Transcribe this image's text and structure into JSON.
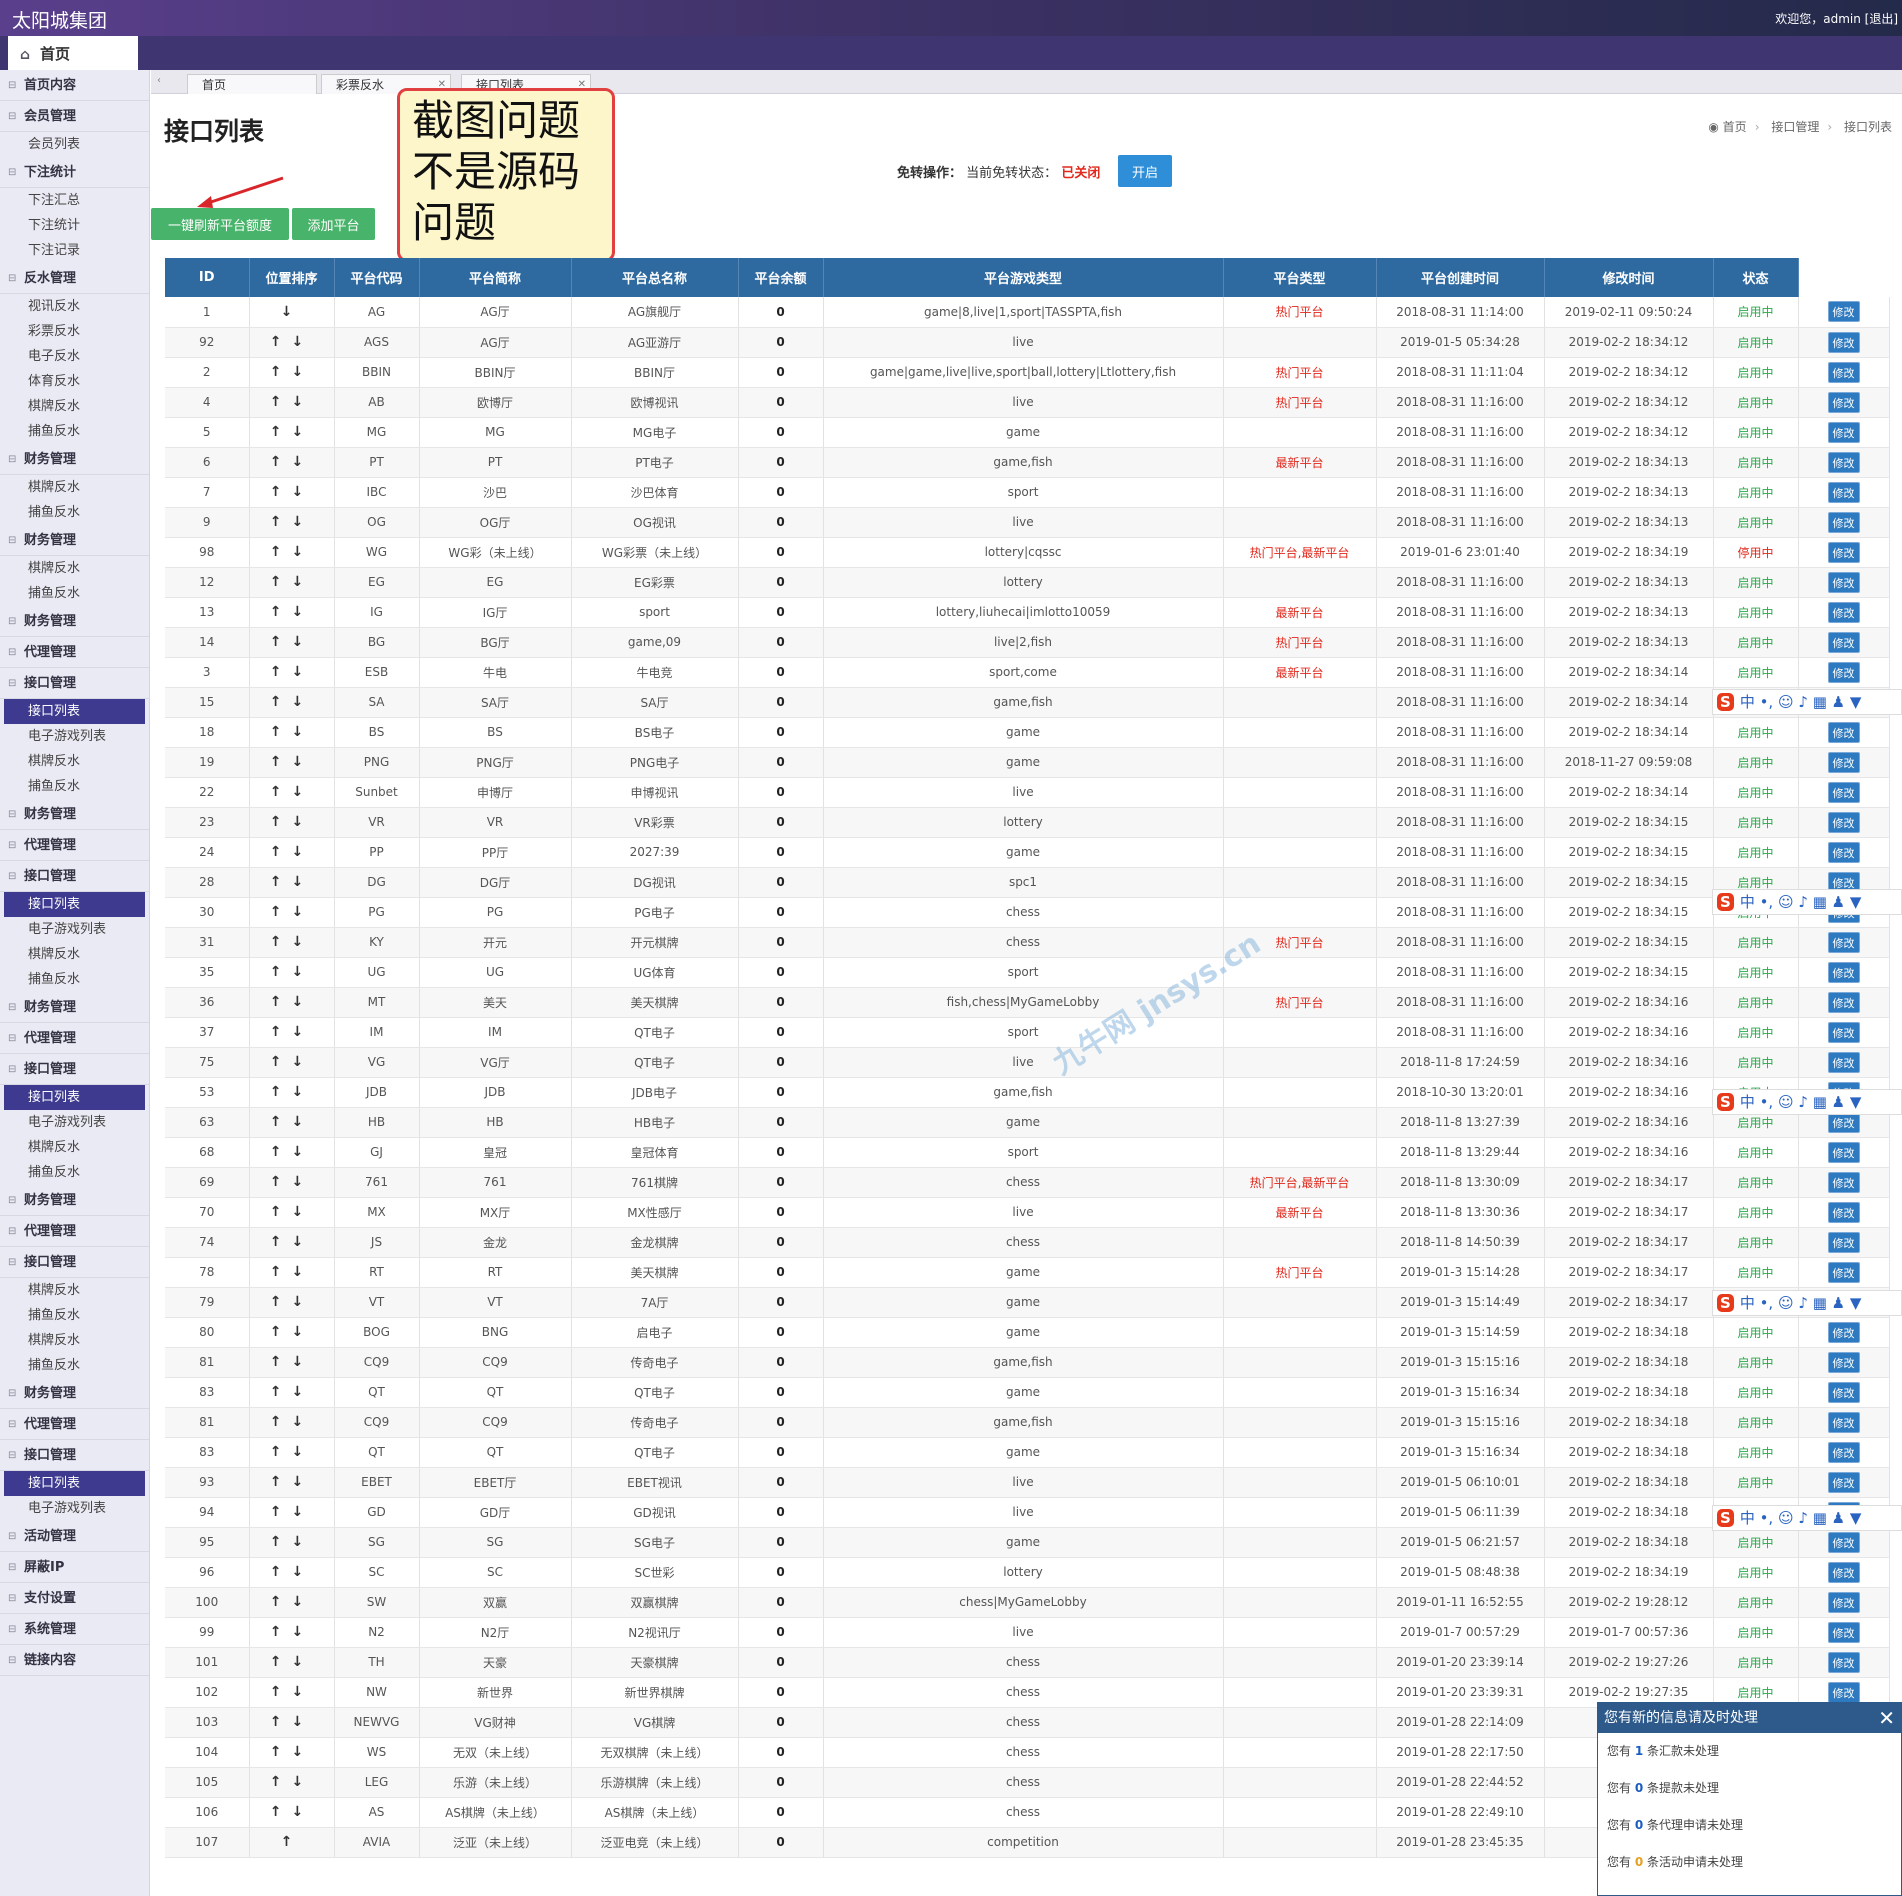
{
  "app": {
    "brand": "太阳城集团",
    "welcome": "欢迎您，admin [退出]",
    "home_tab": "首页"
  },
  "sidebar": [
    {
      "label": "首页内容",
      "type": "group"
    },
    {
      "label": "会员管理",
      "type": "group"
    },
    {
      "label": "会员列表",
      "type": "item"
    },
    {
      "label": "下注统计",
      "type": "group"
    },
    {
      "label": "下注汇总",
      "type": "item"
    },
    {
      "label": "下注统计",
      "type": "item"
    },
    {
      "label": "下注记录",
      "type": "item"
    },
    {
      "label": "反水管理",
      "type": "group"
    },
    {
      "label": "视讯反水",
      "type": "item"
    },
    {
      "label": "彩票反水",
      "type": "item"
    },
    {
      "label": "电子反水",
      "type": "item"
    },
    {
      "label": "体育反水",
      "type": "item"
    },
    {
      "label": "棋牌反水",
      "type": "item"
    },
    {
      "label": "捕鱼反水",
      "type": "item"
    },
    {
      "label": "财务管理",
      "type": "group"
    },
    {
      "label": "棋牌反水",
      "type": "item"
    },
    {
      "label": "捕鱼反水",
      "type": "item"
    },
    {
      "label": "财务管理",
      "type": "group"
    },
    {
      "label": "棋牌反水",
      "type": "item"
    },
    {
      "label": "捕鱼反水",
      "type": "item"
    },
    {
      "label": "财务管理",
      "type": "group"
    },
    {
      "label": "代理管理",
      "type": "group"
    },
    {
      "label": "接口管理",
      "type": "group"
    },
    {
      "label": "接口列表",
      "type": "item",
      "active": true
    },
    {
      "label": "电子游戏列表",
      "type": "item"
    },
    {
      "label": "棋牌反水",
      "type": "item"
    },
    {
      "label": "捕鱼反水",
      "type": "item"
    },
    {
      "label": "财务管理",
      "type": "group"
    },
    {
      "label": "代理管理",
      "type": "group"
    },
    {
      "label": "接口管理",
      "type": "group"
    },
    {
      "label": "接口列表",
      "type": "item",
      "active": true
    },
    {
      "label": "电子游戏列表",
      "type": "item"
    },
    {
      "label": "棋牌反水",
      "type": "item"
    },
    {
      "label": "捕鱼反水",
      "type": "item"
    },
    {
      "label": "财务管理",
      "type": "group"
    },
    {
      "label": "代理管理",
      "type": "group"
    },
    {
      "label": "接口管理",
      "type": "group"
    },
    {
      "label": "接口列表",
      "type": "item",
      "active": true
    },
    {
      "label": "电子游戏列表",
      "type": "item"
    },
    {
      "label": "棋牌反水",
      "type": "item"
    },
    {
      "label": "捕鱼反水",
      "type": "item"
    },
    {
      "label": "财务管理",
      "type": "group"
    },
    {
      "label": "代理管理",
      "type": "group"
    },
    {
      "label": "接口管理",
      "type": "group"
    },
    {
      "label": "棋牌反水",
      "type": "item"
    },
    {
      "label": "捕鱼反水",
      "type": "item"
    },
    {
      "label": "棋牌反水",
      "type": "item"
    },
    {
      "label": "捕鱼反水",
      "type": "item"
    },
    {
      "label": "财务管理",
      "type": "group"
    },
    {
      "label": "代理管理",
      "type": "group"
    },
    {
      "label": "接口管理",
      "type": "group"
    },
    {
      "label": "接口列表",
      "type": "item",
      "active": true
    },
    {
      "label": "电子游戏列表",
      "type": "item"
    },
    {
      "label": "活动管理",
      "type": "group"
    },
    {
      "label": "屏蔽IP",
      "type": "group"
    },
    {
      "label": "支付设置",
      "type": "group"
    },
    {
      "label": "系统管理",
      "type": "group"
    },
    {
      "label": "链接内容",
      "type": "group"
    }
  ],
  "tabs": [
    {
      "label": "首页"
    },
    {
      "label": "彩票反水"
    },
    {
      "label": "接口列表"
    }
  ],
  "page": {
    "title": "接口列表",
    "breadcrumb": [
      "首页",
      "接口管理",
      "接口列表"
    ],
    "toggle_label": "免转操作：",
    "toggle_state_prefix": "当前免转状态：",
    "toggle_state": "已关闭",
    "open_button": "开启",
    "refresh_button": "一键刷新平台额度",
    "add_button": "添加平台"
  },
  "annotation": "截图问题不是源码问题",
  "watermark": "九牛网 jnsys.cn",
  "table": {
    "headers": [
      "ID",
      "位置排序",
      "平台代码",
      "平台简称",
      "平台总名称",
      "平台余额",
      "平台游戏类型",
      "平台类型",
      "平台创建时间",
      "修改时间",
      "状态",
      ""
    ],
    "edit_label": "修改",
    "rows": [
      [
        "1",
        "↓",
        "AG",
        "AG厅",
        "AG旗舰厅",
        "0",
        "game|8,live|1,sport|TASSPTA,fish",
        "热门平台",
        "2018-08-31 11:14:00",
        "2019-02-11 09:50:24",
        "启用中"
      ],
      [
        "92",
        "↑↓",
        "AGS",
        "AG厅",
        "AG亚游厅",
        "0",
        "live",
        "",
        "2019-01-5 05:34:28",
        "2019-02-2 18:34:12",
        "启用中"
      ],
      [
        "2",
        "↑↓",
        "BBIN",
        "BBIN厅",
        "BBIN厅",
        "0",
        "game|game,live|live,sport|ball,lottery|Ltlottery,fish",
        "热门平台",
        "2018-08-31 11:11:04",
        "2019-02-2 18:34:12",
        "启用中"
      ],
      [
        "4",
        "↑↓",
        "AB",
        "欧博厅",
        "欧博视讯",
        "0",
        "live",
        "热门平台",
        "2018-08-31 11:16:00",
        "2019-02-2 18:34:12",
        "启用中"
      ],
      [
        "5",
        "↑↓",
        "MG",
        "MG",
        "MG电子",
        "0",
        "game",
        "",
        "2018-08-31 11:16:00",
        "2019-02-2 18:34:12",
        "启用中"
      ],
      [
        "6",
        "↑↓",
        "PT",
        "PT",
        "PT电子",
        "0",
        "game,fish",
        "最新平台",
        "2018-08-31 11:16:00",
        "2019-02-2 18:34:13",
        "启用中"
      ],
      [
        "7",
        "↑↓",
        "IBC",
        "沙巴",
        "沙巴体育",
        "0",
        "sport",
        "",
        "2018-08-31 11:16:00",
        "2019-02-2 18:34:13",
        "启用中"
      ],
      [
        "9",
        "↑↓",
        "OG",
        "OG厅",
        "OG视讯",
        "0",
        "live",
        "",
        "2018-08-31 11:16:00",
        "2019-02-2 18:34:13",
        "启用中"
      ],
      [
        "98",
        "↑↓",
        "WG",
        "WG彩（未上线）",
        "WG彩票（未上线）",
        "0",
        "lottery|cqssc",
        "热门平台,最新平台",
        "2019-01-6 23:01:40",
        "2019-02-2 18:34:19",
        "停用中"
      ],
      [
        "12",
        "↑↓",
        "EG",
        "EG",
        "EG彩票",
        "0",
        "lottery",
        "",
        "2018-08-31 11:16:00",
        "2019-02-2 18:34:13",
        "启用中"
      ],
      [
        "13",
        "↑↓",
        "IG",
        "IG厅",
        "sport",
        "0",
        "lottery,liuhecai|imlotto10059",
        "最新平台",
        "2018-08-31 11:16:00",
        "2019-02-2 18:34:13",
        "启用中"
      ],
      [
        "14",
        "↑↓",
        "BG",
        "BG厅",
        "game,09",
        "0",
        "live|2,fish",
        "热门平台",
        "2018-08-31 11:16:00",
        "2019-02-2 18:34:13",
        "启用中"
      ],
      [
        "3",
        "↑↓",
        "ESB",
        "牛电",
        "牛电竞",
        "0",
        "sport,come",
        "最新平台",
        "2018-08-31 11:16:00",
        "2019-02-2 18:34:14",
        "启用中"
      ],
      [
        "15",
        "↑↓",
        "SA",
        "SA厅",
        "SA厅",
        "0",
        "game,fish",
        "",
        "2018-08-31 11:16:00",
        "2019-02-2 18:34:14",
        "启用中"
      ],
      [
        "18",
        "↑↓",
        "BS",
        "BS",
        "BS电子",
        "0",
        "game",
        "",
        "2018-08-31 11:16:00",
        "2019-02-2 18:34:14",
        "启用中"
      ],
      [
        "19",
        "↑↓",
        "PNG",
        "PNG厅",
        "PNG电子",
        "0",
        "game",
        "",
        "2018-08-31 11:16:00",
        "2018-11-27 09:59:08",
        "启用中"
      ],
      [
        "22",
        "↑↓",
        "Sunbet",
        "申博厅",
        "申博视讯",
        "0",
        "live",
        "",
        "2018-08-31 11:16:00",
        "2019-02-2 18:34:14",
        "启用中"
      ],
      [
        "23",
        "↑↓",
        "VR",
        "VR",
        "VR彩票",
        "0",
        "lottery",
        "",
        "2018-08-31 11:16:00",
        "2019-02-2 18:34:15",
        "启用中"
      ],
      [
        "24",
        "↑↓",
        "PP",
        "PP厅",
        "2027:39",
        "0",
        "game",
        "",
        "2018-08-31 11:16:00",
        "2019-02-2 18:34:15",
        "启用中"
      ],
      [
        "28",
        "↑↓",
        "DG",
        "DG厅",
        "DG视讯",
        "0",
        "spc1",
        "",
        "2018-08-31 11:16:00",
        "2019-02-2 18:34:15",
        "启用中"
      ],
      [
        "30",
        "↑↓",
        "PG",
        "PG",
        "PG电子",
        "0",
        "chess",
        "",
        "2018-08-31 11:16:00",
        "2019-02-2 18:34:15",
        "启用中"
      ],
      [
        "31",
        "↑↓",
        "KY",
        "开元",
        "开元棋牌",
        "0",
        "chess",
        "热门平台",
        "2018-08-31 11:16:00",
        "2019-02-2 18:34:15",
        "启用中"
      ],
      [
        "35",
        "↑↓",
        "UG",
        "UG",
        "UG体育",
        "0",
        "sport",
        "",
        "2018-08-31 11:16:00",
        "2019-02-2 18:34:15",
        "启用中"
      ],
      [
        "36",
        "↑↓",
        "MT",
        "美天",
        "美天棋牌",
        "0",
        "fish,chess|MyGameLobby",
        "热门平台",
        "2018-08-31 11:16:00",
        "2019-02-2 18:34:16",
        "启用中"
      ],
      [
        "37",
        "↑↓",
        "IM",
        "IM",
        "QT电子",
        "0",
        "sport",
        "",
        "2018-08-31 11:16:00",
        "2019-02-2 18:34:16",
        "启用中"
      ],
      [
        "75",
        "↑↓",
        "VG",
        "VG厅",
        "QT电子",
        "0",
        "live",
        "",
        "2018-11-8 17:24:59",
        "2019-02-2 18:34:16",
        "启用中"
      ],
      [
        "53",
        "↑↓",
        "JDB",
        "JDB",
        "JDB电子",
        "0",
        "game,fish",
        "",
        "2018-10-30 13:20:01",
        "2019-02-2 18:34:16",
        "启用中"
      ],
      [
        "63",
        "↑↓",
        "HB",
        "HB",
        "HB电子",
        "0",
        "game",
        "",
        "2018-11-8 13:27:39",
        "2019-02-2 18:34:16",
        "启用中"
      ],
      [
        "68",
        "↑↓",
        "GJ",
        "皇冠",
        "皇冠体育",
        "0",
        "sport",
        "",
        "2018-11-8 13:29:44",
        "2019-02-2 18:34:16",
        "启用中"
      ],
      [
        "69",
        "↑↓",
        "761",
        "761",
        "761棋牌",
        "0",
        "chess",
        "热门平台,最新平台",
        "2018-11-8 13:30:09",
        "2019-02-2 18:34:17",
        "启用中"
      ],
      [
        "70",
        "↑↓",
        "MX",
        "MX厅",
        "MX性感厅",
        "0",
        "live",
        "最新平台",
        "2018-11-8 13:30:36",
        "2019-02-2 18:34:17",
        "启用中"
      ],
      [
        "74",
        "↑↓",
        "JS",
        "金龙",
        "金龙棋牌",
        "0",
        "chess",
        "",
        "2018-11-8 14:50:39",
        "2019-02-2 18:34:17",
        "启用中"
      ],
      [
        "78",
        "↑↓",
        "RT",
        "RT",
        "美天棋牌",
        "0",
        "game",
        "热门平台",
        "2019-01-3 15:14:28",
        "2019-02-2 18:34:17",
        "启用中"
      ],
      [
        "79",
        "↑↓",
        "VT",
        "VT",
        "7A厅",
        "0",
        "game",
        "",
        "2019-01-3 15:14:49",
        "2019-02-2 18:34:17",
        "启用中"
      ],
      [
        "80",
        "↑↓",
        "BOG",
        "BNG",
        "启电子",
        "0",
        "game",
        "",
        "2019-01-3 15:14:59",
        "2019-02-2 18:34:18",
        "启用中"
      ],
      [
        "81",
        "↑↓",
        "CQ9",
        "CQ9",
        "传奇电子",
        "0",
        "game,fish",
        "",
        "2019-01-3 15:15:16",
        "2019-02-2 18:34:18",
        "启用中"
      ],
      [
        "83",
        "↑↓",
        "QT",
        "QT",
        "QT电子",
        "0",
        "game",
        "",
        "2019-01-3 15:16:34",
        "2019-02-2 18:34:18",
        "启用中"
      ],
      [
        "81",
        "↑↓",
        "CQ9",
        "CQ9",
        "传奇电子",
        "0",
        "game,fish",
        "",
        "2019-01-3 15:15:16",
        "2019-02-2 18:34:18",
        "启用中"
      ],
      [
        "83",
        "↑↓",
        "QT",
        "QT",
        "QT电子",
        "0",
        "game",
        "",
        "2019-01-3 15:16:34",
        "2019-02-2 18:34:18",
        "启用中"
      ],
      [
        "93",
        "↑↓",
        "EBET",
        "EBET厅",
        "EBET视讯",
        "0",
        "live",
        "",
        "2019-01-5 06:10:01",
        "2019-02-2 18:34:18",
        "启用中"
      ],
      [
        "94",
        "↑↓",
        "GD",
        "GD厅",
        "GD视讯",
        "0",
        "live",
        "",
        "2019-01-5 06:11:39",
        "2019-02-2 18:34:18",
        "启用中"
      ],
      [
        "95",
        "↑↓",
        "SG",
        "SG",
        "SG电子",
        "0",
        "game",
        "",
        "2019-01-5 06:21:57",
        "2019-02-2 18:34:18",
        "启用中"
      ],
      [
        "96",
        "↑↓",
        "SC",
        "SC",
        "SC世彩",
        "0",
        "lottery",
        "",
        "2019-01-5 08:48:38",
        "2019-02-2 18:34:19",
        "启用中"
      ],
      [
        "100",
        "↑↓",
        "SW",
        "双赢",
        "双赢棋牌",
        "0",
        "chess|MyGameLobby",
        "",
        "2019-01-11 16:52:55",
        "2019-02-2 19:28:12",
        "启用中"
      ],
      [
        "99",
        "↑↓",
        "N2",
        "N2厅",
        "N2视讯厅",
        "0",
        "live",
        "",
        "2019-01-7 00:57:29",
        "2019-01-7 00:57:36",
        "启用中"
      ],
      [
        "101",
        "↑↓",
        "TH",
        "天豪",
        "天豪棋牌",
        "0",
        "chess",
        "",
        "2019-01-20 23:39:14",
        "2019-02-2 19:27:26",
        "启用中"
      ],
      [
        "102",
        "↑↓",
        "NW",
        "新世界",
        "新世界棋牌",
        "0",
        "chess",
        "",
        "2019-01-20 23:39:31",
        "2019-02-2 19:27:35",
        "启用中"
      ],
      [
        "103",
        "↑↓",
        "NEWVG",
        "VG财神",
        "VG棋牌",
        "0",
        "chess",
        "",
        "2019-01-28 22:14:09",
        "2019",
        "启用中"
      ],
      [
        "104",
        "↑↓",
        "WS",
        "无双（未上线）",
        "无双棋牌（未上线）",
        "0",
        "chess",
        "",
        "2019-01-28 22:17:50",
        "2019",
        "启用中"
      ],
      [
        "105",
        "↑↓",
        "LEG",
        "乐游（未上线）",
        "乐游棋牌（未上线）",
        "0",
        "chess",
        "",
        "2019-01-28 22:44:52",
        "201",
        "启用中"
      ],
      [
        "106",
        "↑↓",
        "AS",
        "AS棋牌（未上线）",
        "AS棋牌（未上线）",
        "0",
        "chess",
        "",
        "2019-01-28 22:49:10",
        "2019",
        "启用中"
      ],
      [
        "107",
        "↑",
        "AVIA",
        "泛亚（未上线）",
        "泛亚电竞（未上线）",
        "0",
        "competition",
        "",
        "2019-01-28 23:45:35",
        "201",
        "启用中"
      ]
    ]
  },
  "notice": {
    "title": "您有新的信息请及时处理",
    "lines": [
      {
        "pre": "您有",
        "num": "1",
        "post": "条汇款未处理"
      },
      {
        "pre": "您有",
        "num": "0",
        "post": "条提款未处理"
      },
      {
        "pre": "您有",
        "num": "0",
        "post": "条代理申请未处理"
      },
      {
        "pre": "您有",
        "num": "0",
        "post": "条活动申请未处理"
      }
    ]
  },
  "ime": {
    "logo": "S",
    "glyphs": "中 •, ☺ ♪ ▦ ♟ ▼"
  },
  "colors": {
    "header_bg": "#2e6aa0",
    "active_nav": "#3d3a8f",
    "green_btn": "#48b36a",
    "blue_btn": "#2e8fd8",
    "status_on": "#2aaa4a",
    "status_off": "#e0281c"
  }
}
